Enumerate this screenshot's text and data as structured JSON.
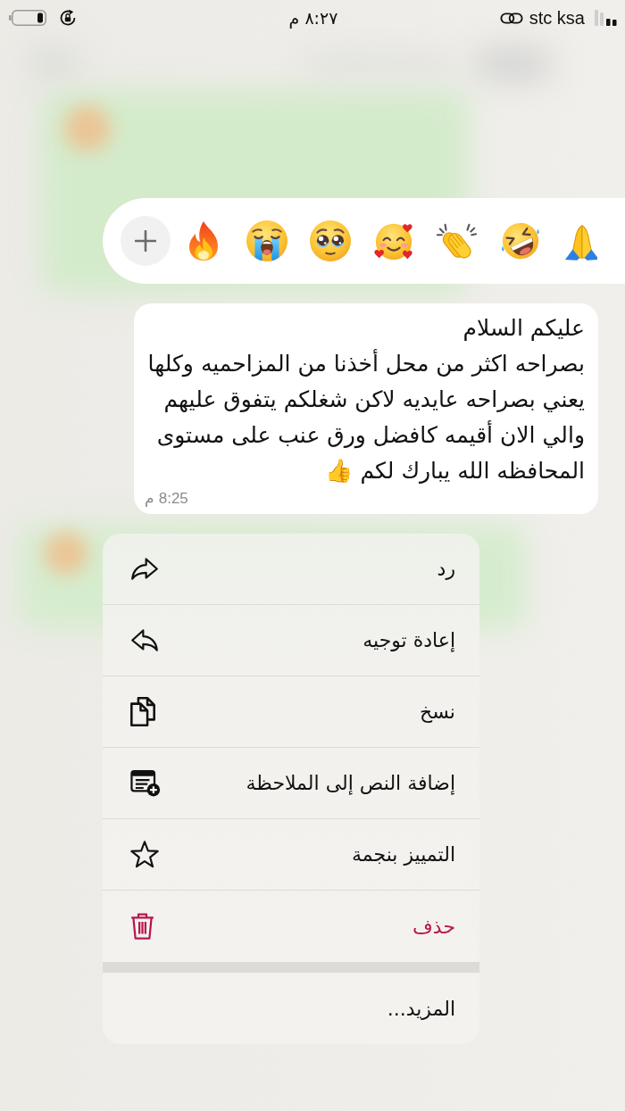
{
  "status_bar": {
    "time": "٨:٢٧ م",
    "carrier": "stc ksa"
  },
  "reaction_bar": {
    "reactions": [
      {
        "kind": "fire"
      },
      {
        "kind": "crying"
      },
      {
        "kind": "pleading"
      },
      {
        "kind": "hearts"
      },
      {
        "kind": "clapping"
      },
      {
        "kind": "laughing"
      },
      {
        "kind": "folded_hands"
      }
    ]
  },
  "message": {
    "text": "عليكم السلام\nبصراحه اكثر من محل أخذنا من المزاحميه وكلها يعني بصراحه عايديه لاكن شغلكم يتفوق عليهم والي الان أقيمه كافضل ورق عنب على مستوى المحافظه الله يبارك لكم 👍",
    "time": "8:25 م"
  },
  "menu": {
    "sections": [
      {
        "items": [
          {
            "label": "رد",
            "kind": "reply",
            "destructive": false
          },
          {
            "label": "إعادة توجيه",
            "kind": "forward",
            "destructive": false
          },
          {
            "label": "نسخ",
            "kind": "copy",
            "destructive": false
          },
          {
            "label": "إضافة النص إلى الملاحظة",
            "kind": "add_note",
            "destructive": false
          },
          {
            "label": "التمييز بنجمة",
            "kind": "star",
            "destructive": false
          },
          {
            "label": "حذف",
            "kind": "delete",
            "destructive": true
          }
        ]
      },
      {
        "items": [
          {
            "label": "المزيد...",
            "kind": "more",
            "destructive": false
          }
        ]
      }
    ]
  }
}
